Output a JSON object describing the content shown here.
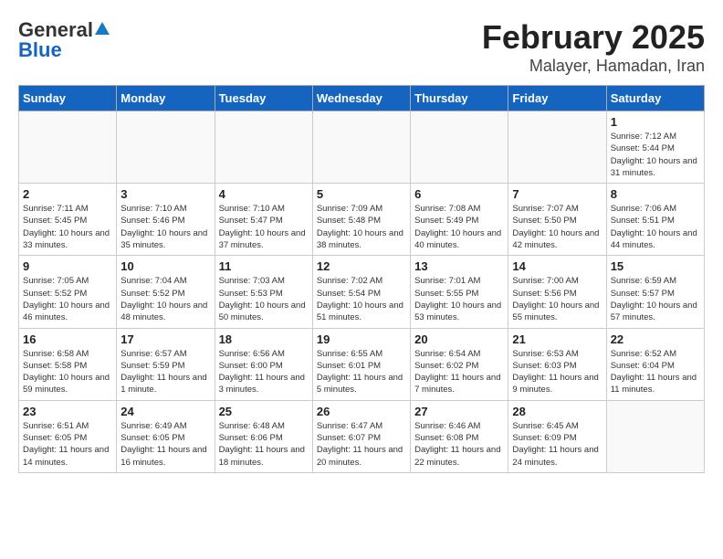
{
  "header": {
    "logo_general": "General",
    "logo_blue": "Blue",
    "title": "February 2025",
    "subtitle": "Malayer, Hamadan, Iran"
  },
  "weekdays": [
    "Sunday",
    "Monday",
    "Tuesday",
    "Wednesday",
    "Thursday",
    "Friday",
    "Saturday"
  ],
  "weeks": [
    [
      {
        "day": "",
        "info": ""
      },
      {
        "day": "",
        "info": ""
      },
      {
        "day": "",
        "info": ""
      },
      {
        "day": "",
        "info": ""
      },
      {
        "day": "",
        "info": ""
      },
      {
        "day": "",
        "info": ""
      },
      {
        "day": "1",
        "info": "Sunrise: 7:12 AM\nSunset: 5:44 PM\nDaylight: 10 hours and 31 minutes."
      }
    ],
    [
      {
        "day": "2",
        "info": "Sunrise: 7:11 AM\nSunset: 5:45 PM\nDaylight: 10 hours and 33 minutes."
      },
      {
        "day": "3",
        "info": "Sunrise: 7:10 AM\nSunset: 5:46 PM\nDaylight: 10 hours and 35 minutes."
      },
      {
        "day": "4",
        "info": "Sunrise: 7:10 AM\nSunset: 5:47 PM\nDaylight: 10 hours and 37 minutes."
      },
      {
        "day": "5",
        "info": "Sunrise: 7:09 AM\nSunset: 5:48 PM\nDaylight: 10 hours and 38 minutes."
      },
      {
        "day": "6",
        "info": "Sunrise: 7:08 AM\nSunset: 5:49 PM\nDaylight: 10 hours and 40 minutes."
      },
      {
        "day": "7",
        "info": "Sunrise: 7:07 AM\nSunset: 5:50 PM\nDaylight: 10 hours and 42 minutes."
      },
      {
        "day": "8",
        "info": "Sunrise: 7:06 AM\nSunset: 5:51 PM\nDaylight: 10 hours and 44 minutes."
      }
    ],
    [
      {
        "day": "9",
        "info": "Sunrise: 7:05 AM\nSunset: 5:52 PM\nDaylight: 10 hours and 46 minutes."
      },
      {
        "day": "10",
        "info": "Sunrise: 7:04 AM\nSunset: 5:52 PM\nDaylight: 10 hours and 48 minutes."
      },
      {
        "day": "11",
        "info": "Sunrise: 7:03 AM\nSunset: 5:53 PM\nDaylight: 10 hours and 50 minutes."
      },
      {
        "day": "12",
        "info": "Sunrise: 7:02 AM\nSunset: 5:54 PM\nDaylight: 10 hours and 51 minutes."
      },
      {
        "day": "13",
        "info": "Sunrise: 7:01 AM\nSunset: 5:55 PM\nDaylight: 10 hours and 53 minutes."
      },
      {
        "day": "14",
        "info": "Sunrise: 7:00 AM\nSunset: 5:56 PM\nDaylight: 10 hours and 55 minutes."
      },
      {
        "day": "15",
        "info": "Sunrise: 6:59 AM\nSunset: 5:57 PM\nDaylight: 10 hours and 57 minutes."
      }
    ],
    [
      {
        "day": "16",
        "info": "Sunrise: 6:58 AM\nSunset: 5:58 PM\nDaylight: 10 hours and 59 minutes."
      },
      {
        "day": "17",
        "info": "Sunrise: 6:57 AM\nSunset: 5:59 PM\nDaylight: 11 hours and 1 minute."
      },
      {
        "day": "18",
        "info": "Sunrise: 6:56 AM\nSunset: 6:00 PM\nDaylight: 11 hours and 3 minutes."
      },
      {
        "day": "19",
        "info": "Sunrise: 6:55 AM\nSunset: 6:01 PM\nDaylight: 11 hours and 5 minutes."
      },
      {
        "day": "20",
        "info": "Sunrise: 6:54 AM\nSunset: 6:02 PM\nDaylight: 11 hours and 7 minutes."
      },
      {
        "day": "21",
        "info": "Sunrise: 6:53 AM\nSunset: 6:03 PM\nDaylight: 11 hours and 9 minutes."
      },
      {
        "day": "22",
        "info": "Sunrise: 6:52 AM\nSunset: 6:04 PM\nDaylight: 11 hours and 11 minutes."
      }
    ],
    [
      {
        "day": "23",
        "info": "Sunrise: 6:51 AM\nSunset: 6:05 PM\nDaylight: 11 hours and 14 minutes."
      },
      {
        "day": "24",
        "info": "Sunrise: 6:49 AM\nSunset: 6:05 PM\nDaylight: 11 hours and 16 minutes."
      },
      {
        "day": "25",
        "info": "Sunrise: 6:48 AM\nSunset: 6:06 PM\nDaylight: 11 hours and 18 minutes."
      },
      {
        "day": "26",
        "info": "Sunrise: 6:47 AM\nSunset: 6:07 PM\nDaylight: 11 hours and 20 minutes."
      },
      {
        "day": "27",
        "info": "Sunrise: 6:46 AM\nSunset: 6:08 PM\nDaylight: 11 hours and 22 minutes."
      },
      {
        "day": "28",
        "info": "Sunrise: 6:45 AM\nSunset: 6:09 PM\nDaylight: 11 hours and 24 minutes."
      },
      {
        "day": "",
        "info": ""
      }
    ]
  ]
}
